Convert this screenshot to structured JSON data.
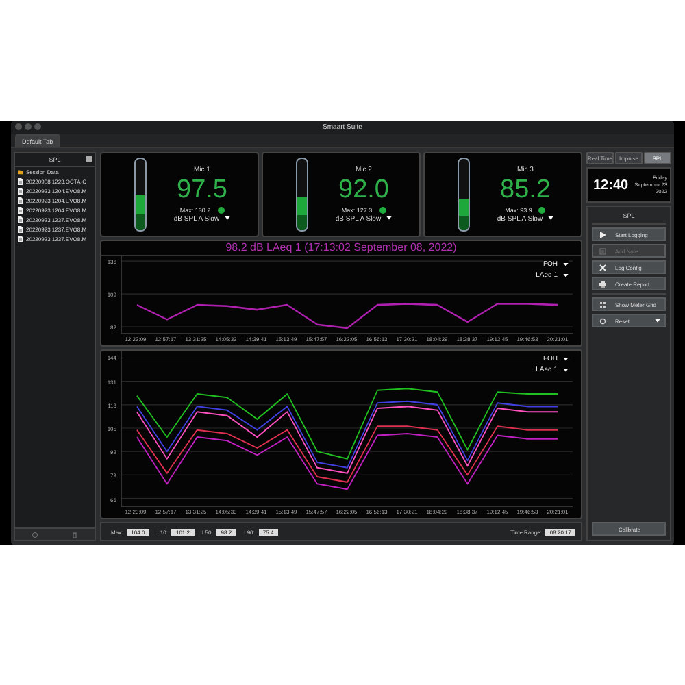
{
  "window": {
    "title": "Smaart Suite"
  },
  "tabs": [
    {
      "label": "Default Tab",
      "selected": true
    }
  ],
  "sidebar": {
    "title": "SPL",
    "folder": "Session Data",
    "files": [
      "20220908.1223.OCTA-C",
      "20220923.1204.EVO8.M",
      "20220923.1204.EVO8.M",
      "20220923.1204.EVO8.M",
      "20220923.1237.EVO8.M",
      "20220923.1237.EVO8.M",
      "20220923.1237.EVO8.M"
    ]
  },
  "meters": [
    {
      "name": "Mic 1",
      "value": "97.5",
      "max": "Max: 130.2",
      "mode": "dB SPL A Slow",
      "level": 0.5
    },
    {
      "name": "Mic 2",
      "value": "92.0",
      "max": "Max: 127.3",
      "mode": "dB SPL A Slow",
      "level": 0.47
    },
    {
      "name": "Mic 3",
      "value": "85.2",
      "max": "Max: 93.9",
      "mode": "dB SPL A Slow",
      "level": 0.45
    }
  ],
  "top_chart": {
    "title": "98.2 dB LAeq 1 (17:13:02 September 08, 2022)",
    "selectors": [
      "FOH",
      "LAeq 1"
    ],
    "chart_data": {
      "type": "line",
      "grid": true,
      "ylim": [
        77,
        140
      ],
      "yticks": [
        {
          "value": 136,
          "label": "136"
        },
        {
          "value": 109,
          "label": "109"
        },
        {
          "value": 82,
          "label": "82"
        }
      ],
      "categories": [
        "12:23:09",
        "12:57:17",
        "13:31:25",
        "14:05:33",
        "14:39:41",
        "15:13:49",
        "15:47:57",
        "16:22:05",
        "16:56:13",
        "17:30:21",
        "18:04:29",
        "18:38:37",
        "19:12:45",
        "19:46:53",
        "20:21:01"
      ],
      "series": [
        {
          "color": "#b020b0",
          "values": [
            100,
            88,
            100,
            99,
            96,
            100,
            84,
            81,
            100,
            101,
            100,
            86,
            101,
            101,
            100
          ]
        }
      ]
    }
  },
  "bottom_chart": {
    "selectors": [
      "FOH",
      "LAeq 1"
    ],
    "chart_data": {
      "type": "line",
      "grid": true,
      "ylim": [
        62,
        148
      ],
      "yticks": [
        {
          "value": 144,
          "label": "144"
        },
        {
          "value": 131,
          "label": "131"
        },
        {
          "value": 118,
          "label": "118"
        },
        {
          "value": 105,
          "label": "105"
        },
        {
          "value": 92,
          "label": "92"
        },
        {
          "value": 79,
          "label": "79"
        },
        {
          "value": 66,
          "label": "66"
        }
      ],
      "categories": [
        "12:23:09",
        "12:57:17",
        "13:31:25",
        "14:05:33",
        "14:39:41",
        "15:13:49",
        "15:47:57",
        "16:22:05",
        "16:56:13",
        "17:30:21",
        "18:04:29",
        "18:38:37",
        "19:12:45",
        "19:46:53",
        "20:21:01"
      ],
      "series": [
        {
          "color": "#c020c0",
          "values": [
            100,
            74,
            100,
            98,
            90,
            100,
            74,
            71,
            101,
            102,
            100,
            74,
            101,
            99,
            99
          ]
        },
        {
          "color": "#e03050",
          "values": [
            104,
            80,
            104,
            102,
            94,
            104,
            78,
            75,
            106,
            106,
            104,
            79,
            106,
            104,
            104
          ]
        },
        {
          "color": "#ff50c0",
          "values": [
            114,
            88,
            114,
            112,
            100,
            114,
            83,
            80,
            116,
            117,
            115,
            84,
            116,
            114,
            114
          ]
        },
        {
          "color": "#4040e0",
          "values": [
            117,
            92,
            117,
            115,
            104,
            117,
            86,
            83,
            119,
            120,
            118,
            87,
            119,
            117,
            117
          ]
        },
        {
          "color": "#20c020",
          "values": [
            123,
            100,
            124,
            122,
            110,
            124,
            92,
            88,
            126,
            127,
            125,
            93,
            125,
            124,
            124
          ]
        }
      ]
    }
  },
  "stats": [
    {
      "label": "Max:",
      "value": "104.0"
    },
    {
      "label": "L10:",
      "value": "101.2"
    },
    {
      "label": "L50:",
      "value": "98.2"
    },
    {
      "label": "L90:",
      "value": "75.4"
    }
  ],
  "time_range": {
    "label": "Time Range:",
    "value": "08:20:17"
  },
  "mode_tabs": [
    {
      "label": "Real Time",
      "selected": false
    },
    {
      "label": "Impulse",
      "selected": false
    },
    {
      "label": "SPL",
      "selected": true
    }
  ],
  "clock": {
    "time": "12:40",
    "day": "Friday",
    "date": "September 23",
    "year": "2022"
  },
  "panel": {
    "title": "SPL",
    "actions": [
      {
        "kind": "play",
        "label": "Start Logging",
        "disabled": false,
        "dropdown": false
      },
      {
        "kind": "note",
        "label": "Add Note",
        "disabled": true,
        "dropdown": false
      },
      {
        "kind": "tools",
        "label": "Log Config",
        "disabled": false,
        "dropdown": false
      },
      {
        "kind": "report",
        "label": "Create Report",
        "disabled": false,
        "dropdown": false
      },
      {
        "kind": "grid",
        "label": "Show Meter Grid",
        "disabled": false,
        "dropdown": false
      },
      {
        "kind": "reset",
        "label": "Reset",
        "disabled": false,
        "dropdown": true
      }
    ],
    "calibrate": "Calibrate"
  }
}
